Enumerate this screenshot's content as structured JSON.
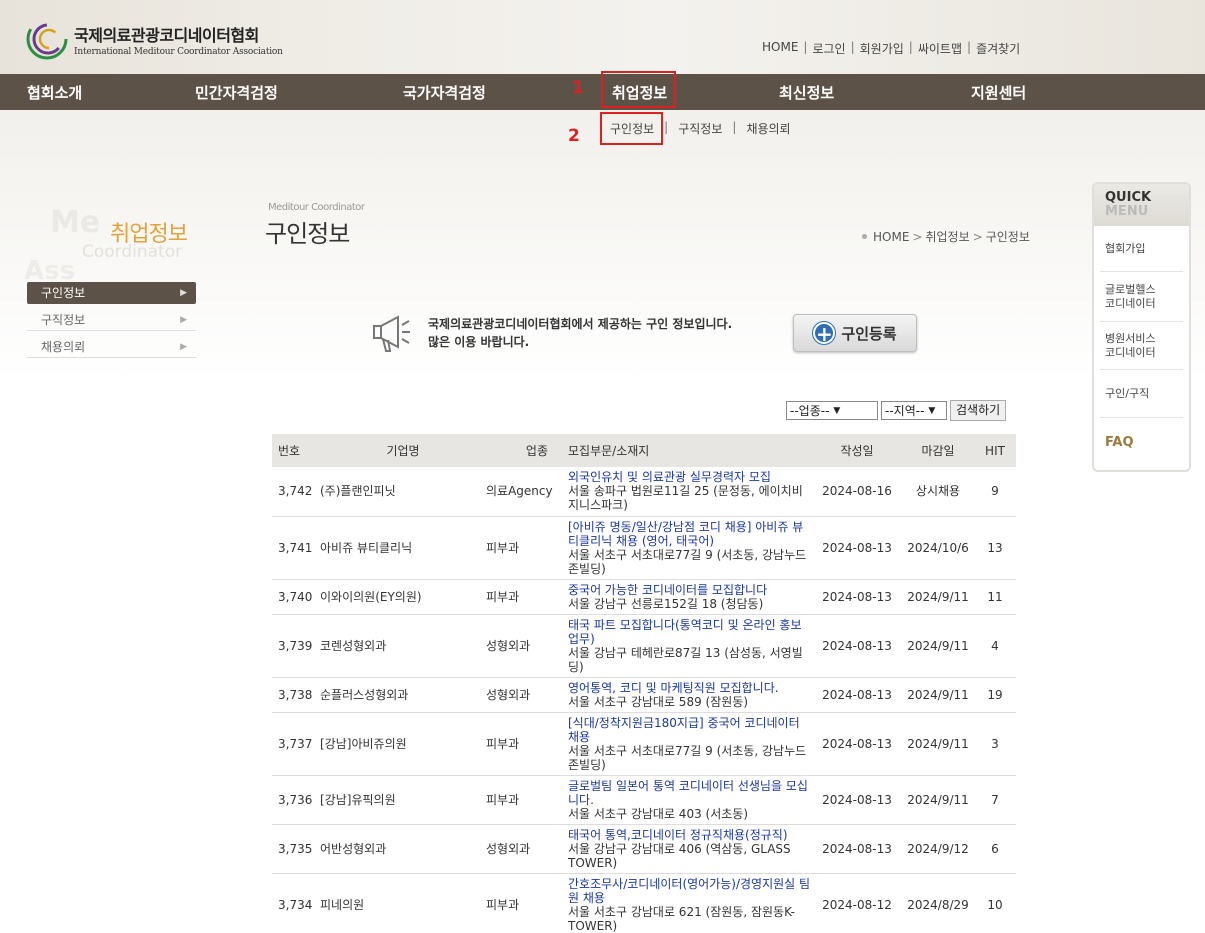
{
  "header": {
    "logo_kr": "국제의료관광코디네이터협회",
    "logo_en": "International Meditour Coordinator Association",
    "util": [
      "HOME",
      "로그인",
      "회원가입",
      "싸이트맵",
      "즐겨찾기"
    ]
  },
  "gnb": [
    "협회소개",
    "민간자격검정",
    "국가자격검정",
    "취업정보",
    "최신정보",
    "지원센터"
  ],
  "annotations": {
    "n1": "1",
    "n2": "2"
  },
  "submenu": [
    "구인정보",
    "구직정보",
    "채용의뢰"
  ],
  "sidebar": {
    "title": "취업정보",
    "ghost": [
      "Me",
      "Coordinator",
      "Ass"
    ],
    "items": [
      "구인정보",
      "구직정보",
      "채용의뢰"
    ]
  },
  "page": {
    "small_caption": "Meditour Coordinator",
    "title": "구인정보",
    "breadcrumb": [
      "HOME",
      "취업정보",
      "구인정보"
    ]
  },
  "notice": {
    "line1": "국제의료관광코디네이터협회에서 제공하는 구인 정보입니다.",
    "line2": "많은 이용 바랍니다.",
    "register_label": "구인등록"
  },
  "search": {
    "industry_selected": "--업종--",
    "region_selected": "--지역--",
    "button": "검색하기"
  },
  "table": {
    "headers": [
      "번호",
      "기업명",
      "업종",
      "모집부문/소재지",
      "작성일",
      "마감일",
      "HIT"
    ],
    "rows": [
      {
        "no": "3,742",
        "company": "(주)플랜인피닛",
        "industry": "의료Agency",
        "title": "외국인유치 및 의료관광 실무경력자 모집",
        "address": "서울 송파구 법원로11길 25 (문정동, 에이치비지니스파크)",
        "date": "2024-08-16",
        "close": "상시채용",
        "hit": "9"
      },
      {
        "no": "3,741",
        "company": "아비쥬 뷰티클리닉",
        "industry": "피부과",
        "title": "[아비쥬 명동/일산/강남점 코디 채용] 아비쥬 뷰티클리닉 채용 (영어, 태국어)",
        "address": "서울 서초구 서초대로77길 9 (서초동, 강남누드존빌딩)",
        "date": "2024-08-13",
        "close": "2024/10/6",
        "hit": "13"
      },
      {
        "no": "3,740",
        "company": "이와이의원(EY의원)",
        "industry": "피부과",
        "title": "중국어 가능한 코디네이터를 모집합니다",
        "address": "서울 강남구 선릉로152길 18 (청담동)",
        "date": "2024-08-13",
        "close": "2024/9/11",
        "hit": "11"
      },
      {
        "no": "3,739",
        "company": "코렌성형외과",
        "industry": "성형외과",
        "title": "태국 파트 모집합니다(통역코디 및 온라인 홍보업무)",
        "address": "서울 강남구 테헤란로87길 13 (삼성동, 서영빌딩)",
        "date": "2024-08-13",
        "close": "2024/9/11",
        "hit": "4"
      },
      {
        "no": "3,738",
        "company": "순플러스성형외과",
        "industry": "성형외과",
        "title": "영어통역, 코디 및 마케팅직원 모집합니다.",
        "address": "서울 서초구 강남대로 589 (잠원동)",
        "date": "2024-08-13",
        "close": "2024/9/11",
        "hit": "19"
      },
      {
        "no": "3,737",
        "company": "[강남]아비쥬의원",
        "industry": "피부과",
        "title": "[식대/정착지원금180지급] 중국어 코디네이터 채용",
        "address": "서울 서초구 서초대로77길 9 (서초동, 강남누드존빌딩)",
        "date": "2024-08-13",
        "close": "2024/9/11",
        "hit": "3"
      },
      {
        "no": "3,736",
        "company": "[강남]유픽의원",
        "industry": "피부과",
        "title": "글로벌팀 일본어 통역 코디네이터 선생님을 모십니다.",
        "address": "서울 서초구 강남대로 403 (서초동)",
        "date": "2024-08-13",
        "close": "2024/9/11",
        "hit": "7"
      },
      {
        "no": "3,735",
        "company": "어반성형외과",
        "industry": "성형외과",
        "title": "태국어 통역,코디네이터 정규직채용(정규직)",
        "address": "서울 강남구 강남대로 406 (역삼동, GLASS TOWER)",
        "date": "2024-08-13",
        "close": "2024/9/12",
        "hit": "6"
      },
      {
        "no": "3,734",
        "company": "피네의원",
        "industry": "피부과",
        "title": "간호조무사/코디네이터(영어가능)/경영지원실 팀원 채용",
        "address": "서울 서초구 강남대로 621 (잠원동, 잠원동K-TOWER)",
        "date": "2024-08-12",
        "close": "2024/8/29",
        "hit": "10"
      }
    ]
  },
  "quick": {
    "title1": "QUICK",
    "title2": "MENU",
    "items": [
      "협회가입",
      "글로벌헬스\n코디네이터",
      "병원서비스\n코디네이터",
      "구인/구직",
      "FAQ"
    ]
  },
  "colors": {
    "nav": "#5c5247",
    "accent_orange": "#e3a23b",
    "link_blue": "#1a37a6",
    "annotation_red": "#e02020"
  }
}
